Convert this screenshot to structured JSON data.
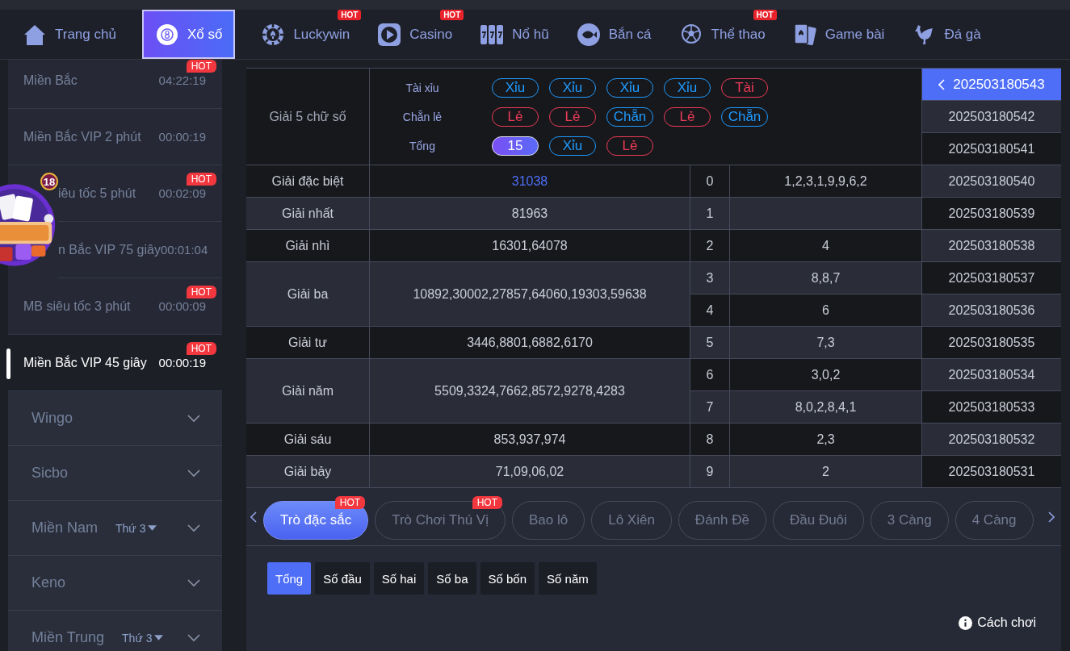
{
  "nav": [
    {
      "label": "Trang chủ",
      "kind": "home",
      "selected": false
    },
    {
      "label": "Xổ số",
      "kind": "lottery",
      "selected": true
    },
    {
      "label": "Luckywin",
      "kind": "chip",
      "selected": false,
      "badge": "HOT"
    },
    {
      "label": "Casino",
      "kind": "play",
      "selected": false,
      "badge": "HOT"
    },
    {
      "label": "Nổ hũ",
      "kind": "slot",
      "selected": false
    },
    {
      "label": "Bắn cá",
      "kind": "fish",
      "selected": false
    },
    {
      "label": "Thể thao",
      "kind": "sport",
      "selected": false,
      "badge": "HOT"
    },
    {
      "label": "Game bài",
      "kind": "cards",
      "selected": false
    },
    {
      "label": "Đá gà",
      "kind": "rooster",
      "selected": false
    }
  ],
  "lotteries": [
    {
      "label": "Miền Bắc",
      "time": "04:22:19",
      "badge": "HOT",
      "selected": false,
      "kind": "full"
    },
    {
      "label": "Miền Bắc VIP 2 phút",
      "time": "00:00:19",
      "selected": false,
      "kind": "full"
    },
    {
      "label": "iêu tốc 5 phút",
      "time": "00:02:09",
      "badge": "HOT",
      "selected": false,
      "kind": "covered"
    },
    {
      "label": "n Bắc VIP 75 giây",
      "time": "00:01:04",
      "selected": false,
      "kind": "covered"
    },
    {
      "label": "MB siêu tốc 3 phút",
      "time": "00:00:09",
      "badge": "HOT",
      "selected": false,
      "kind": "full"
    },
    {
      "label": "Miền Bắc VIP 45 giây",
      "time": "00:00:19",
      "badge": "HOT",
      "selected": true,
      "kind": "full"
    }
  ],
  "categories": [
    {
      "label": "Wingo",
      "expanded": false
    },
    {
      "label": "Sicbo",
      "expanded": false
    },
    {
      "label": "Miền Nam",
      "day": "Thứ 3",
      "expanded": false
    },
    {
      "label": "Keno",
      "expanded": false
    },
    {
      "label": "Miền Trung",
      "day": "Thứ 3",
      "expanded": false
    }
  ],
  "mini_games": {
    "badge": "18"
  },
  "summary": {
    "title": "Giải 5 chữ số",
    "rows": [
      {
        "label": "Tài xỉu",
        "pills": [
          {
            "text": "Xỉu",
            "kind": "xiu"
          },
          {
            "text": "Xỉu",
            "kind": "xiu"
          },
          {
            "text": "Xỉu",
            "kind": "xiu"
          },
          {
            "text": "Xỉu",
            "kind": "xiu"
          },
          {
            "text": "Tài",
            "kind": "tai"
          }
        ]
      },
      {
        "label": "Chẵn lẻ",
        "pills": [
          {
            "text": "Lẻ",
            "kind": "le"
          },
          {
            "text": "Lẻ",
            "kind": "le"
          },
          {
            "text": "Chẵn",
            "kind": "chan"
          },
          {
            "text": "Lẻ",
            "kind": "le"
          },
          {
            "text": "Chẵn",
            "kind": "chan"
          }
        ]
      },
      {
        "label": "Tổng",
        "pills": [
          {
            "text": "15",
            "kind": "total"
          },
          {
            "text": "Xỉu",
            "kind": "xiu"
          },
          {
            "text": "Lẻ",
            "kind": "le"
          }
        ]
      }
    ]
  },
  "prizes": [
    {
      "name": "Giải đặc biệt",
      "value": "31038",
      "highlight": true,
      "kind": "single"
    },
    {
      "name": "Giải nhất",
      "value": "81963",
      "highlight": false,
      "kind": "single"
    },
    {
      "name": "Giải nhì",
      "value": "16301,64078",
      "highlight": false,
      "kind": "single"
    },
    {
      "name": "Giải ba",
      "value": "10892,30002,27857,64060,19303,59638",
      "highlight": false,
      "kind": "double"
    },
    {
      "name": "Giải tư",
      "value": "3446,8801,6882,6170",
      "highlight": false,
      "kind": "single"
    },
    {
      "name": "Giải năm",
      "value": "5509,3324,7662,8572,9278,4283",
      "highlight": false,
      "kind": "double"
    },
    {
      "name": "Giải sáu",
      "value": "853,937,974",
      "highlight": false,
      "kind": "single"
    },
    {
      "name": "Giải bảy",
      "value": "71,09,06,02",
      "highlight": false,
      "kind": "single"
    }
  ],
  "heads": [
    {
      "digit": "0",
      "tails": "1,2,3,1,9,9,6,2"
    },
    {
      "digit": "1"
    },
    {
      "digit": "2",
      "tails": "4"
    },
    {
      "digit": "3",
      "tails": "8,8,7"
    },
    {
      "digit": "4",
      "tails": "6"
    },
    {
      "digit": "5",
      "tails": "7,3"
    },
    {
      "digit": "6",
      "tails": "3,0,2"
    },
    {
      "digit": "7",
      "tails": "8,0,2,8,4,1"
    },
    {
      "digit": "8",
      "tails": "2,3"
    },
    {
      "digit": "9",
      "tails": "2"
    }
  ],
  "periods": [
    {
      "id": "202503180543",
      "selected": true
    },
    {
      "id": "202503180542",
      "selected": false
    },
    {
      "id": "202503180541",
      "selected": false
    },
    {
      "id": "202503180540",
      "selected": false
    },
    {
      "id": "202503180539",
      "selected": false
    },
    {
      "id": "202503180538",
      "selected": false
    },
    {
      "id": "202503180537",
      "selected": false
    },
    {
      "id": "202503180536",
      "selected": false
    },
    {
      "id": "202503180535",
      "selected": false
    },
    {
      "id": "202503180534",
      "selected": false
    },
    {
      "id": "202503180533",
      "selected": false
    },
    {
      "id": "202503180532",
      "selected": false
    },
    {
      "id": "202503180531",
      "selected": false
    }
  ],
  "game_tabs": [
    {
      "label": "Trò đặc sắc",
      "selected": true,
      "badge": "HOT"
    },
    {
      "label": "Trò Chơi Thú Vị",
      "selected": false,
      "badge": "HOT"
    },
    {
      "label": "Bao lô",
      "selected": false
    },
    {
      "label": "Lô Xiên",
      "selected": false
    },
    {
      "label": "Đánh Đề",
      "selected": false
    },
    {
      "label": "Đầu Đuôi",
      "selected": false
    },
    {
      "label": "3 Càng",
      "selected": false
    },
    {
      "label": "4 Càng",
      "selected": false
    }
  ],
  "sub_tabs": [
    {
      "label": "Tổng",
      "selected": true
    },
    {
      "label": "Số đầu",
      "selected": false
    },
    {
      "label": "Số hai",
      "selected": false
    },
    {
      "label": "Số ba",
      "selected": false
    },
    {
      "label": "Số bốn",
      "selected": false
    },
    {
      "label": "Số năm",
      "selected": false
    }
  ],
  "help": "Cách chơi"
}
